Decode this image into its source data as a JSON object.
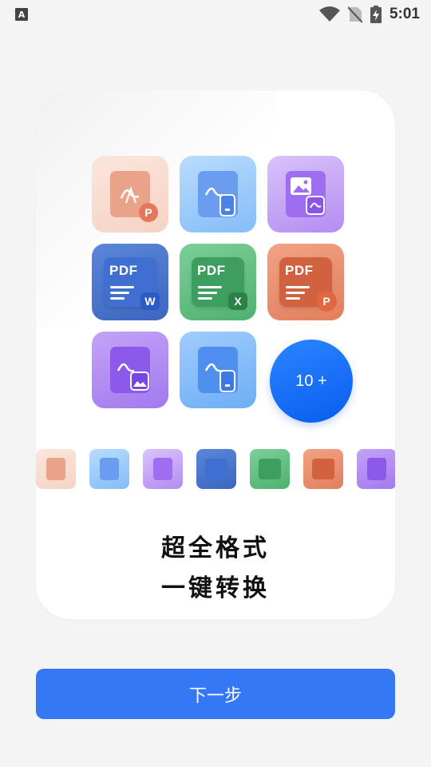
{
  "status_bar": {
    "app_badge": "A",
    "time": "5:01",
    "icons": [
      "wifi-icon",
      "no-sim-icon",
      "battery-charging-icon"
    ]
  },
  "card": {
    "tiles": [
      {
        "name": "pdf-to-ppt-tile",
        "badge": "P",
        "icon": "pdf-file-icon"
      },
      {
        "name": "pdf-to-phone-tile",
        "badge": "",
        "icon": "pdf-mobile-icon"
      },
      {
        "name": "image-to-pdf-tile",
        "badge": "",
        "icon": "image-pdf-icon"
      },
      {
        "name": "pdf-to-word-tile",
        "badge": "W",
        "icon": "pdf-word-icon"
      },
      {
        "name": "pdf-to-excel-tile",
        "badge": "X",
        "icon": "pdf-excel-icon"
      },
      {
        "name": "pdf-to-ppt-orange-tile",
        "badge": "P",
        "icon": "pdf-ppt-icon"
      },
      {
        "name": "pdf-to-image-tile",
        "badge": "",
        "icon": "pdf-image-icon"
      },
      {
        "name": "pdf-to-mobile-tile",
        "badge": "",
        "icon": "pdf-mobile-icon"
      }
    ],
    "pdf_label": "PDF",
    "more_label": "10 +",
    "headline_line1": "超全格式",
    "headline_line2": "一键转换"
  },
  "next_button": "下一步",
  "colors": {
    "accent": "#3478f6",
    "background": "#f4f4f5",
    "card": "#ffffff"
  }
}
